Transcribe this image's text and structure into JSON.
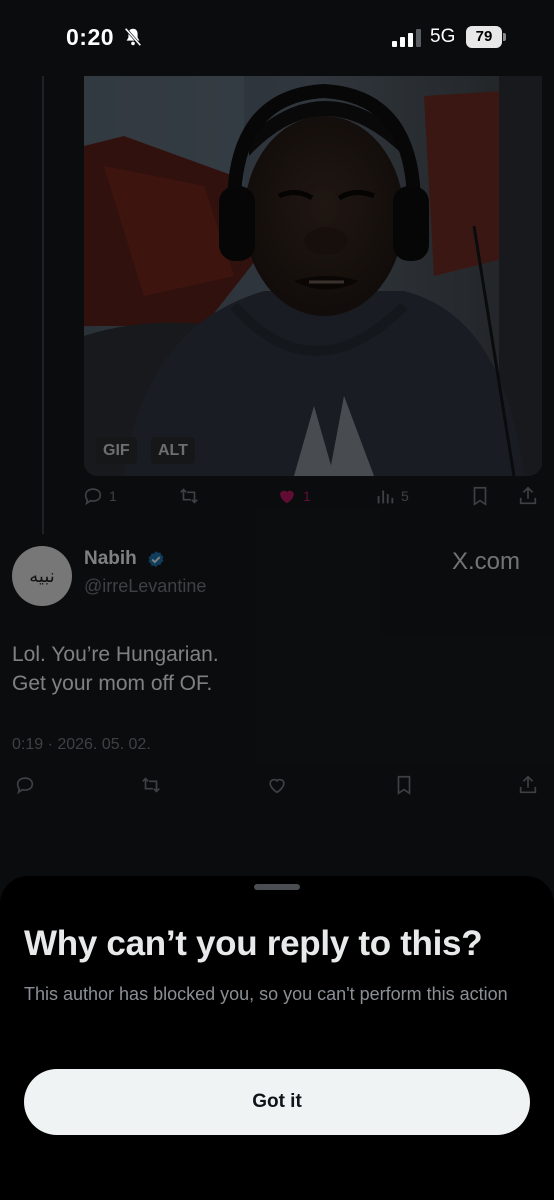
{
  "status_bar": {
    "time": "0:20",
    "network": "5G",
    "battery": "79"
  },
  "media": {
    "badges": [
      "GIF",
      "ALT"
    ]
  },
  "parent_actions": {
    "replies": "1",
    "likes": "1",
    "views": "5"
  },
  "author": {
    "name": "Nabih",
    "handle": "@irreLevantine",
    "avatar_text": "نبيه",
    "source": "X.com"
  },
  "tweet": {
    "line1": "Lol. You’re Hungarian.",
    "line2": "Get your mom off OF.",
    "timestamp": "0:19 · 2026. 05. 02."
  },
  "sheet": {
    "title": "Why can’t you reply to this?",
    "body": "This author has blocked you, so you can't perform this action",
    "button": "Got it"
  },
  "colors": {
    "background": "#15171a",
    "like": "#f91880",
    "verified": "#1d9bf0",
    "sheet": "#000000"
  }
}
